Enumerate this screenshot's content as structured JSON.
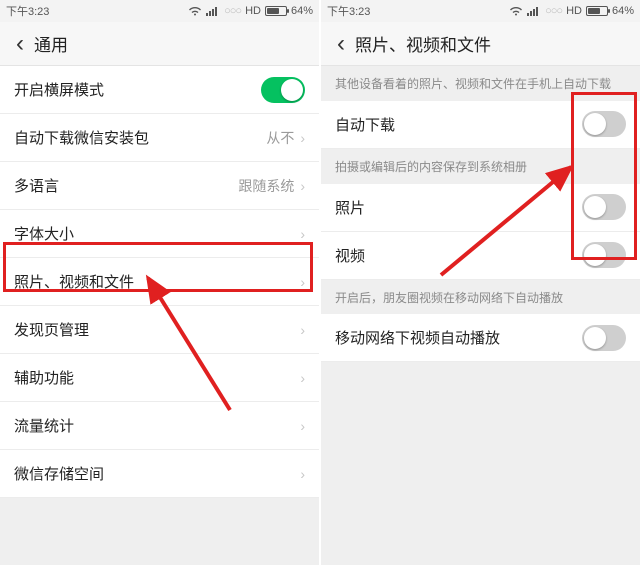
{
  "statusbar": {
    "time": "下午3:23",
    "hd": "HD",
    "battery": "64%"
  },
  "left": {
    "title": "通用",
    "rows": {
      "landscape": "开启横屏模式",
      "autoupdate": {
        "label": "自动下载微信安装包",
        "value": "从不"
      },
      "language": {
        "label": "多语言",
        "value": "跟随系统"
      },
      "fontsize": "字体大小",
      "media": "照片、视频和文件",
      "discover": "发现页管理",
      "a11y": "辅助功能",
      "traffic": "流量统计",
      "storage": "微信存储空间"
    }
  },
  "right": {
    "title": "照片、视频和文件",
    "note1": "其他设备看着的照片、视频和文件在手机上自动下载",
    "rows": {
      "autodl": "自动下载",
      "photo": "照片",
      "video": "视频",
      "mobile": "移动网络下视频自动播放"
    },
    "note2": "拍摄或编辑后的内容保存到系统相册",
    "note3": "开启后，朋友圈视频在移动网络下自动播放"
  },
  "chevron": "›",
  "back": "‹"
}
